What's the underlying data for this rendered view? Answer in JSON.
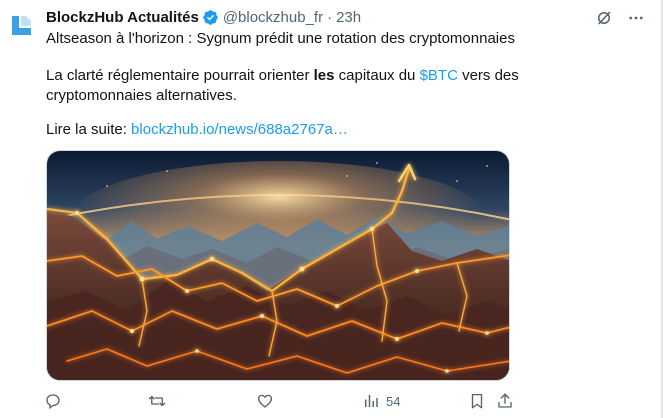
{
  "tweet": {
    "display_name": "BlockzHub Actualités",
    "handle": "@blockzhub_fr",
    "separator": "·",
    "time": "23h",
    "title_line": "Altseason à l'horizon : Sygnum prédit une rotation des cryptomonnaies",
    "body": {
      "part1": "La clarté réglementaire pourrait orienter ",
      "bold": "les",
      "part2": " capitaux du ",
      "cashtag": "$BTC",
      "part3": " vers des",
      "line2": "cryptomonnaies alternatives."
    },
    "read_more_label": "Lire la suite: ",
    "read_more_link": "blockzhub.io/news/688a2767a…",
    "image_icon": "glowing-mountains-crypto-landscape",
    "views_count": "54"
  },
  "icons": {
    "verified": "verified-badge-icon",
    "grok": "grok-icon",
    "more": "more-options-icon",
    "reply": "reply-icon",
    "repost": "repost-icon",
    "like": "like-icon",
    "views": "views-icon",
    "bookmark": "bookmark-icon",
    "share": "share-icon"
  },
  "colors": {
    "link": "#1d9bf0",
    "verified": "#1d9bf0",
    "muted": "#536471",
    "brand": "#1d9bf0"
  }
}
